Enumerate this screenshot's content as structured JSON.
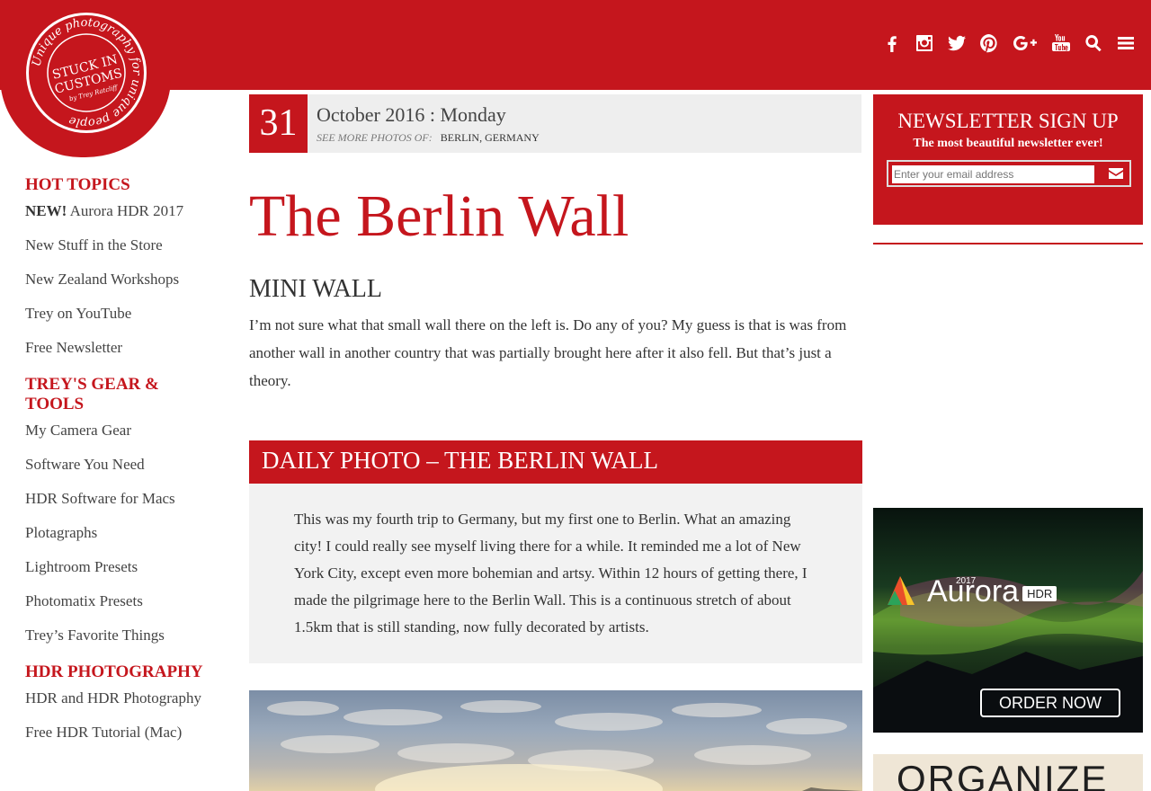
{
  "header": {
    "icons": [
      "facebook-icon",
      "instagram-icon",
      "twitter-icon",
      "pinterest-icon",
      "google-plus-icon",
      "youtube-icon",
      "search-icon",
      "menu-icon"
    ]
  },
  "logo": {
    "ring_text": "Unique photography for unique people",
    "title1": "STUCK IN",
    "title2": "CUSTOMS",
    "byline": "by Trey Ratcliff"
  },
  "sidebar": {
    "hot_topics": {
      "heading": "HOT TOPICS",
      "new_badge": "NEW!",
      "items": [
        "Aurora HDR 2017",
        "New Stuff in the Store",
        "New Zealand Workshops",
        "Trey on YouTube",
        "Free Newsletter"
      ]
    },
    "gear": {
      "heading": "TREY'S GEAR & TOOLS",
      "items": [
        "My Camera Gear",
        "Software You Need",
        "HDR Software for Macs",
        "Plotagraphs",
        "Lightroom Presets",
        "Photomatix Presets",
        "Trey’s Favorite Things"
      ]
    },
    "hdr": {
      "heading": "HDR PHOTOGRAPHY",
      "item1_a": "HDR",
      "item1_and": " and ",
      "item1_b": "HDR Photography",
      "item2": "Free HDR Tutorial (Mac)"
    }
  },
  "post": {
    "day": "31",
    "date_text": "October 2016 : Monday",
    "see_more_label": "SEE MORE PHOTOS OF:",
    "location": "BERLIN, GERMANY",
    "title": "The Berlin Wall",
    "subheading": "MINI WALL",
    "paragraph1": "I’m not sure what that small wall there on the left is. Do any of you? My guess is that is was from another wall in another country that was partially brought here after it also fell. But that’s just a theory.",
    "section_heading": "DAILY PHOTO – THE BERLIN WALL",
    "quote": "This was my fourth trip to Germany, but my first one to Berlin. What an amazing city! I could really see myself living there for a while. It reminded me a lot of New York City, except even more bohemian and artsy. Within 12 hours of getting there, I made the pilgrimage here to the Berlin Wall. This is a continuous stretch of about 1.5km that is still standing, now fully decorated by artists."
  },
  "newsletter": {
    "title": "NEWSLETTER SIGN UP",
    "subtitle": "The most beautiful newsletter ever!",
    "placeholder": "Enter your email address"
  },
  "ads": {
    "aurora_year": "2017",
    "aurora_brand": "Aurora",
    "aurora_hdr": "HDR",
    "order_label": "ORDER NOW",
    "organize_text": "ORGANIZE"
  },
  "colors": {
    "accent": "#c5161d",
    "quote_bg": "#f2f2f2",
    "date_bg": "#eeeeee"
  }
}
